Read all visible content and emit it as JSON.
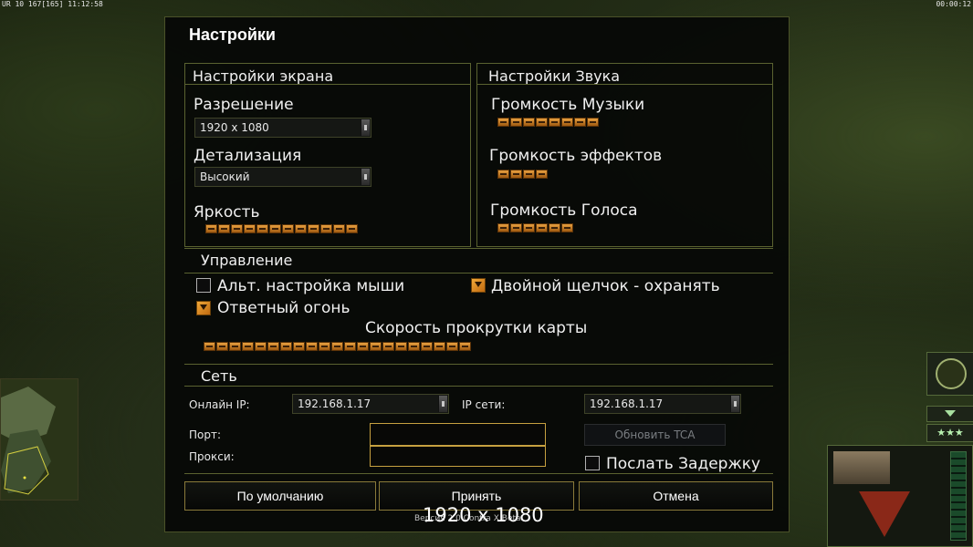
{
  "hud": {
    "top_left": "UR 10 167[165] 11:12:58",
    "top_right": "00:00:12"
  },
  "dialog": {
    "title": "Настройки",
    "screen": {
      "heading": "Настройки экрана",
      "resolution_label": "Разрешение",
      "resolution_value": "1920 x 1080",
      "detail_label": "Детализация",
      "detail_value": "Высокий",
      "brightness_label": "Яркость",
      "brightness_level": 12
    },
    "sound": {
      "heading": "Настройки Звука",
      "music_label": "Громкость Музыки",
      "music_level": 8,
      "effects_label": "Громкость эффектов",
      "effects_level": 4,
      "voice_label": "Громкость Голоса",
      "voice_level": 6
    },
    "controls": {
      "heading": "Управление",
      "alt_mouse_label": "Альт. настройка мыши",
      "alt_mouse_checked": false,
      "double_click_label": "Двойной щелчок - охранять",
      "double_click_checked": true,
      "return_fire_label": "Ответный огонь",
      "return_fire_checked": true,
      "scroll_speed_label": "Скорость прокрутки карты",
      "scroll_speed_level": 21
    },
    "network": {
      "heading": "Сеть",
      "online_ip_label": "Онлайн IP:",
      "online_ip_value": "192.168.1.17",
      "lan_ip_label": "IP сети:",
      "lan_ip_value": "192.168.1.17",
      "port_label": "Порт:",
      "port_value": "",
      "proxy_label": "Прокси:",
      "proxy_value": "",
      "refresh_button": "Обновить TCA",
      "send_delay_label": "Послать Задержку",
      "send_delay_checked": false
    },
    "buttons": {
      "defaults": "По умолчанию",
      "accept": "Принять",
      "cancel": "Отмена"
    },
    "version": "Версия 2.0 Contra X Beta"
  },
  "overlay_resolution": "1920 x 1080",
  "colors": {
    "slider": "#e8a040",
    "panel_border": "#5a6230",
    "button_border": "#8a7a3a",
    "input_border": "#c6a040"
  }
}
